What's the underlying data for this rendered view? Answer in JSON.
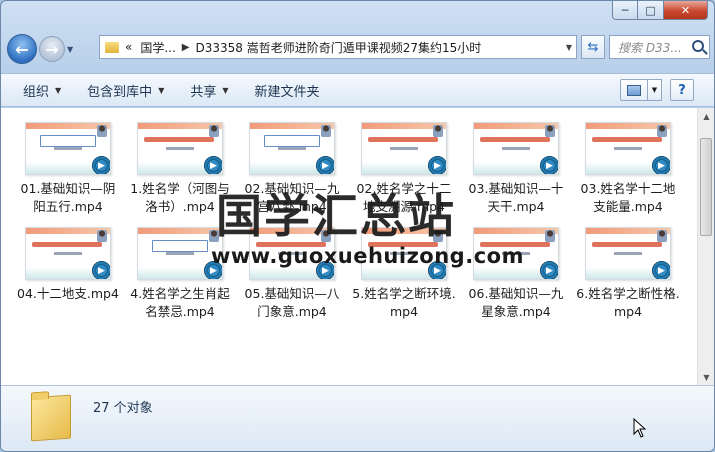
{
  "window": {
    "caption": {
      "minimize": "─",
      "maximize": "□",
      "close": "✕"
    }
  },
  "nav": {
    "back_icon": "back-arrow-icon",
    "forward_icon": "forward-arrow-icon",
    "address": {
      "overflow": "«",
      "crumb1": "国学...",
      "sep": "▶",
      "crumb2": "D33358 嵩哲老师进阶奇门遁甲课视频27集约15小时"
    },
    "refresh_label": "⇆",
    "search_placeholder": "搜索 D33..."
  },
  "toolbar": {
    "organize": "组织",
    "include_in_library": "包含到库中",
    "share": "共享",
    "new_folder": "新建文件夹",
    "help": "?"
  },
  "files": [
    {
      "name": "01.基础知识—阴阳五行.mp4",
      "style": "alt"
    },
    {
      "name": "1.姓名学（河图与洛书）.mp4",
      "style": "main"
    },
    {
      "name": "02.基础知识—九宫八卦.mp4",
      "style": "alt"
    },
    {
      "name": "02.姓名学之十二地支溯源.mp4",
      "style": "main"
    },
    {
      "name": "03.基础知识—十天干.mp4",
      "style": "main"
    },
    {
      "name": "03.姓名学十二地支能量.mp4",
      "style": "main"
    },
    {
      "name": "04.十二地支.mp4",
      "style": "main"
    },
    {
      "name": "4.姓名学之生肖起名禁忌.mp4",
      "style": "alt"
    },
    {
      "name": "05.基础知识—八门象意.mp4",
      "style": "main"
    },
    {
      "name": "5.姓名学之断环境.mp4",
      "style": "main"
    },
    {
      "name": "06.基础知识—九星象意.mp4",
      "style": "main"
    },
    {
      "name": "6.姓名学之断性格.mp4",
      "style": "main"
    }
  ],
  "watermark": {
    "title": "国学汇总站",
    "url": "www.guoxuehuizong.com"
  },
  "status": {
    "count": "27 个对象"
  }
}
